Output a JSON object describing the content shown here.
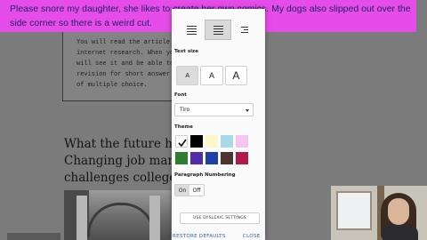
{
  "caption": {
    "line1": "Please snore my daughter, she likes to create her own comics. My dogs also slipped out over the",
    "line2": "side corner so there is a weird cut."
  },
  "article": {
    "quiz_lines": [
      "You will read the article and",
      "internet research. When you",
      "will see it and be able to gra",
      "revision for short answer qua",
      "of multiple choice."
    ],
    "headline_lines": [
      "What the future h",
      "Changing job mar",
      "challenges college"
    ]
  },
  "settings": {
    "text_size_label": "Text size",
    "size_options": [
      "A",
      "A",
      "A"
    ],
    "font_label": "Font",
    "font_value": "Tiro",
    "theme_label": "Theme",
    "theme_colors": [
      "#ffffff",
      "#000000",
      "#fdf6c8",
      "#a9d9e6",
      "#f7c4f2",
      "#2e7d32",
      "#512da8",
      "#1e40a8",
      "#4e342e",
      "#b0174a"
    ],
    "paragraph_label": "Paragraph Numbering",
    "toggle_on": "On",
    "toggle_off": "Off",
    "dyslexic_button": "USE DYSLEXIC SETTINGS",
    "restore_defaults": "RESTORE DEFAULTS",
    "close": "CLOSE"
  }
}
